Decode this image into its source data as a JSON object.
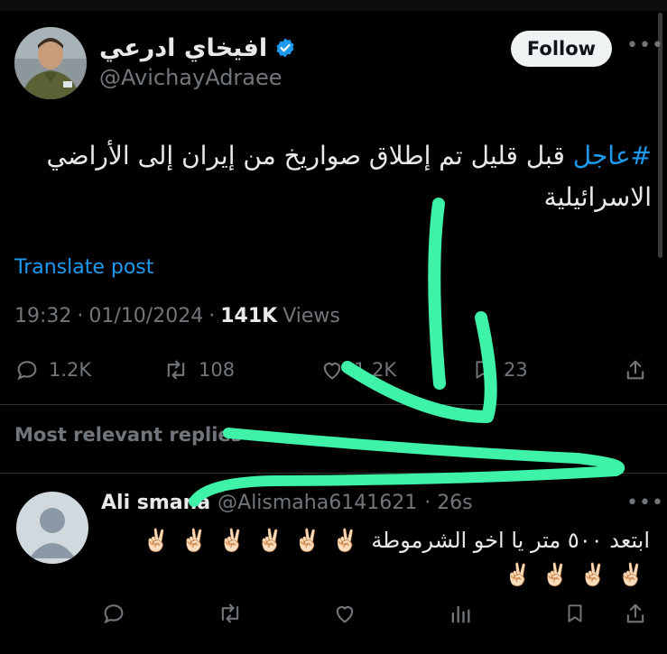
{
  "tweet": {
    "display_name": "افيخاي ادرعي",
    "handle": "@AvichayAdraee",
    "follow_label": "Follow",
    "hashtag": "#عاجل",
    "text": " قبل قليل تم إطلاق صواريخ من إيران إلى الأراضي الاسرائيلية",
    "translate_label": "Translate post",
    "time": "19:32",
    "date": "01/10/2024",
    "views_count": "141K",
    "views_label": "Views",
    "separator": "·",
    "stats": {
      "replies": "1.2K",
      "reposts": "108",
      "likes": "1.2K",
      "bookmarks": "23"
    }
  },
  "replies_section": {
    "sort_label": "Most relevant replies"
  },
  "reply": {
    "name": "Ali smana",
    "handle": "@Alismaha6141621",
    "age": "· 26s",
    "text": "ابتعد ٥٠٠ متر يا اخو الشرموطة",
    "emoji": "✌🏻"
  },
  "icons": [
    "verified-badge-icon",
    "more-icon",
    "reply-icon",
    "repost-icon",
    "like-icon",
    "bookmark-icon",
    "share-icon",
    "analytics-icon",
    "default-avatar-icon"
  ],
  "colors": {
    "background": "#000000",
    "text": "#e7e9ea",
    "muted": "#71767b",
    "link": "#1d9bf0",
    "annotation": "#3ef2a8"
  }
}
